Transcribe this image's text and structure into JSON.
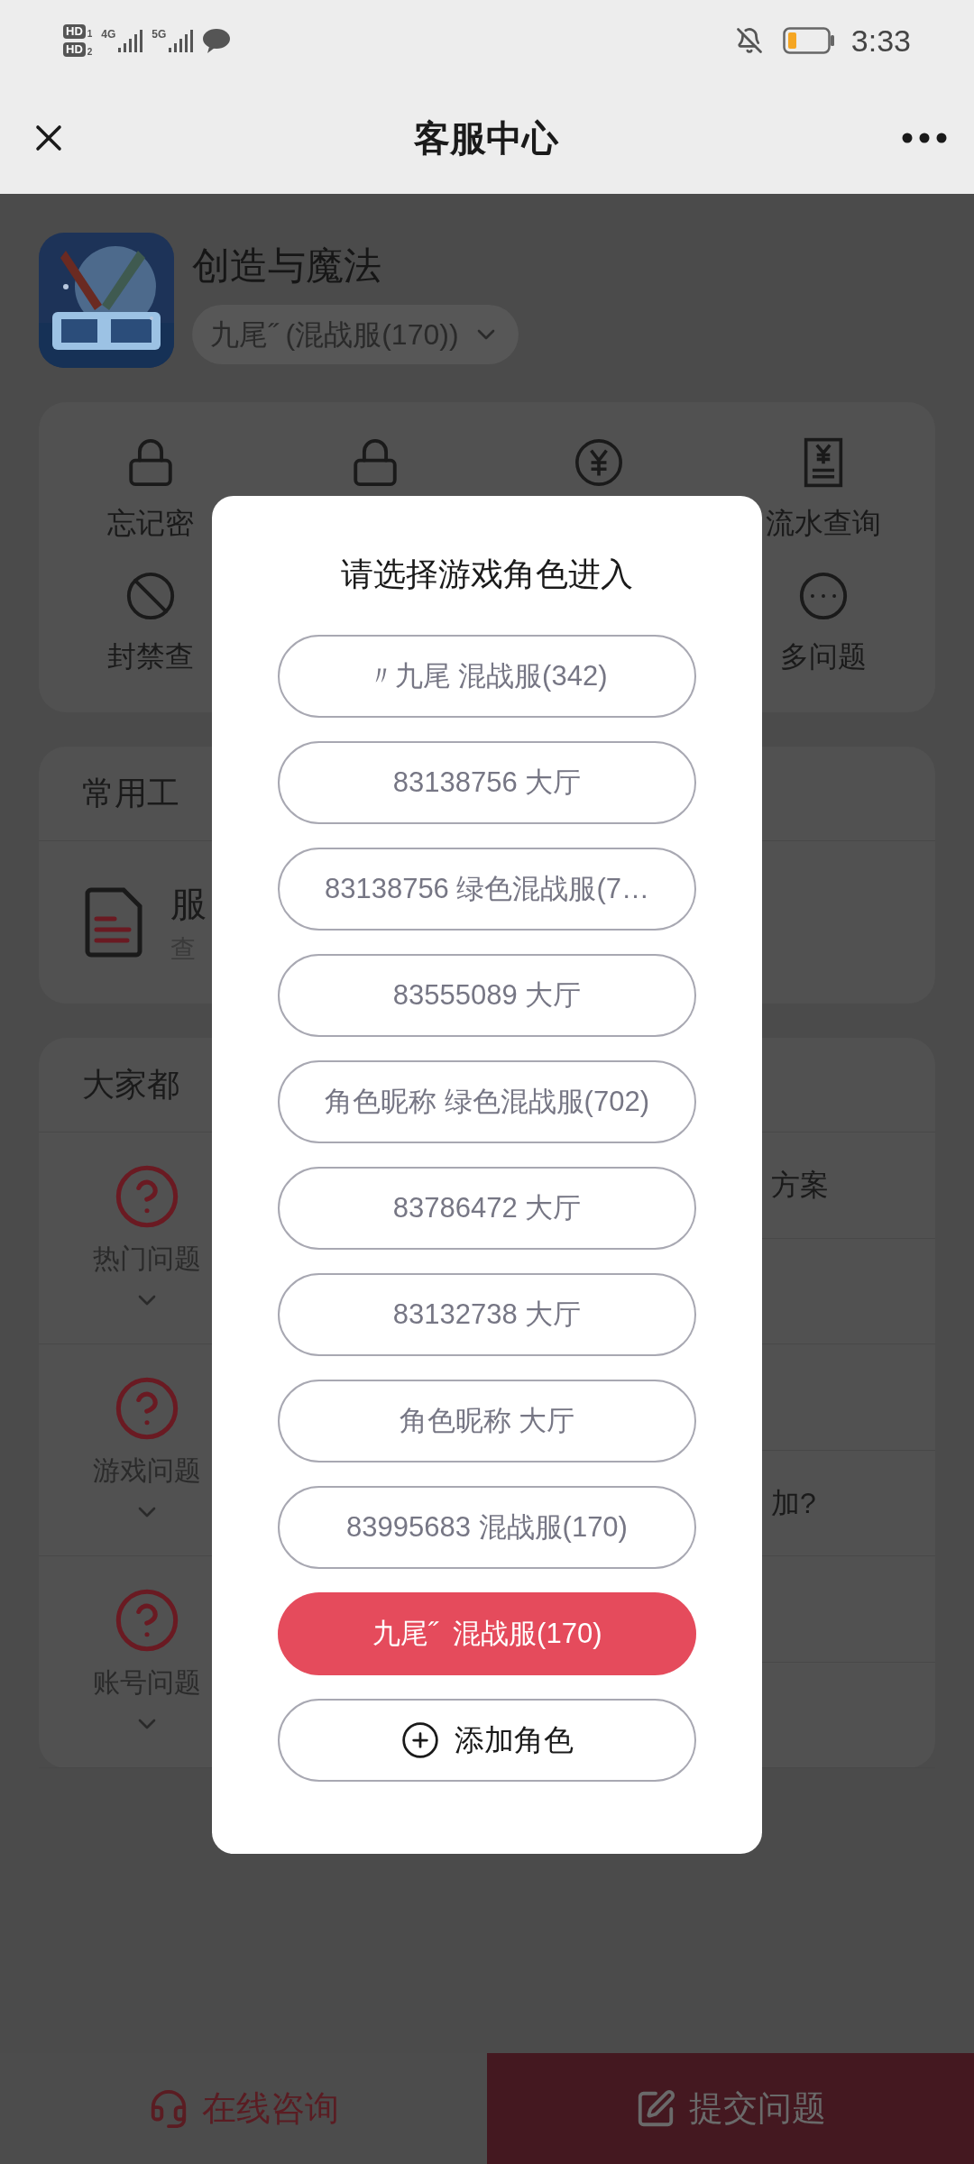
{
  "status_bar": {
    "sims": [
      {
        "label": "HD",
        "slot": "1"
      },
      {
        "label": "HD",
        "slot": "2"
      }
    ],
    "networks": [
      "4G",
      "5G"
    ],
    "time": "3:33"
  },
  "header": {
    "title": "客服中心"
  },
  "game": {
    "name": "创造与魔法",
    "role": "九尾˝ (混战服(170))"
  },
  "quick_actions": [
    [
      {
        "kind": "lock",
        "label": "忘记密"
      },
      {
        "kind": "lock"
      },
      {
        "kind": "yuan"
      },
      {
        "kind": "receipt",
        "label": "流水查询"
      }
    ],
    [
      {
        "kind": "ban",
        "label": "封禁查"
      },
      {
        "kind": "more",
        "label": "多问题"
      }
    ]
  ],
  "tools": {
    "title": "常用工",
    "items": [
      {
        "name": "服",
        "subtitle": "查"
      }
    ]
  },
  "popular": {
    "title": "大家都",
    "categories": [
      {
        "label": "热门问题"
      },
      {
        "label": "游戏问题"
      },
      {
        "label": "账号问题"
      }
    ],
    "questions": [
      {
        "text": "方案"
      },
      {
        "text": "加?"
      }
    ]
  },
  "dialog": {
    "title": "请选择游戏角色进入",
    "roles": [
      {
        "label": "〃九尾 混战服(342)",
        "selected": false
      },
      {
        "label": "83138756 大厅",
        "selected": false
      },
      {
        "label": "83138756 绿色混战服(7…",
        "selected": false
      },
      {
        "label": "83555089 大厅",
        "selected": false
      },
      {
        "label": "角色昵称 绿色混战服(702)",
        "selected": false
      },
      {
        "label": "83786472 大厅",
        "selected": false
      },
      {
        "label": "83132738 大厅",
        "selected": false
      },
      {
        "label": "角色昵称 大厅",
        "selected": false
      },
      {
        "label": "83995683 混战服(170)",
        "selected": false
      },
      {
        "label": "九尾˝  混战服(170)",
        "selected": true
      }
    ],
    "add_button": "添加角色"
  },
  "bottom_bar": [
    {
      "label": "在线咨询",
      "kind": "chat"
    },
    {
      "label": "提交问题",
      "kind": "submit"
    }
  ]
}
